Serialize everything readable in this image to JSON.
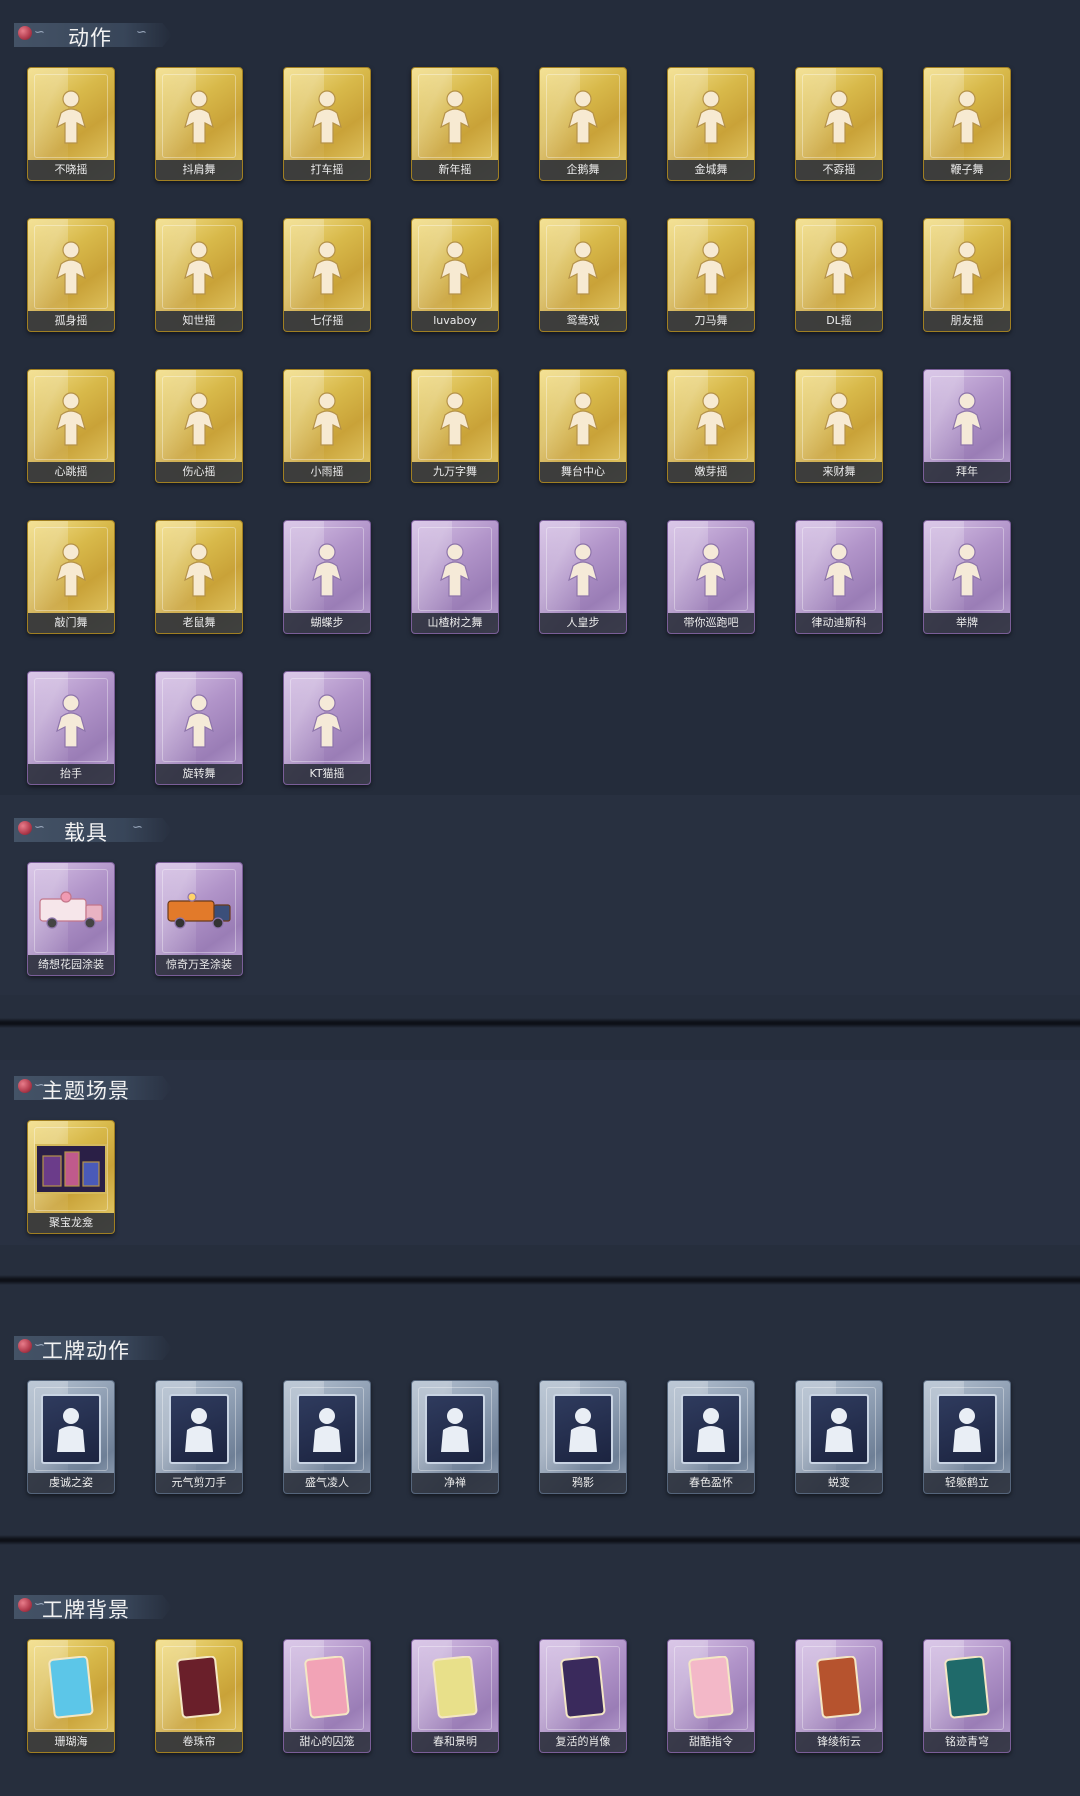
{
  "sections": {
    "actions": {
      "title": "动作",
      "items": [
        {
          "label": "不晓摇",
          "rarity": "gold"
        },
        {
          "label": "抖肩舞",
          "rarity": "gold"
        },
        {
          "label": "打车摇",
          "rarity": "gold"
        },
        {
          "label": "新年摇",
          "rarity": "gold"
        },
        {
          "label": "企鹅舞",
          "rarity": "gold"
        },
        {
          "label": "金城舞",
          "rarity": "gold"
        },
        {
          "label": "不孬摇",
          "rarity": "gold"
        },
        {
          "label": "鞭子舞",
          "rarity": "gold"
        },
        {
          "label": "孤身摇",
          "rarity": "gold"
        },
        {
          "label": "知世摇",
          "rarity": "gold"
        },
        {
          "label": "七仔摇",
          "rarity": "gold"
        },
        {
          "label": "luvaboy",
          "rarity": "gold"
        },
        {
          "label": "鸳鸯戏",
          "rarity": "gold"
        },
        {
          "label": "刀马舞",
          "rarity": "gold"
        },
        {
          "label": "DL摇",
          "rarity": "gold"
        },
        {
          "label": "朋友摇",
          "rarity": "gold"
        },
        {
          "label": "心跳摇",
          "rarity": "gold"
        },
        {
          "label": "伤心摇",
          "rarity": "gold"
        },
        {
          "label": "小雨摇",
          "rarity": "gold"
        },
        {
          "label": "九万字舞",
          "rarity": "gold"
        },
        {
          "label": "舞台中心",
          "rarity": "gold"
        },
        {
          "label": "嫩芽摇",
          "rarity": "gold"
        },
        {
          "label": "来财舞",
          "rarity": "gold"
        },
        {
          "label": "拜年",
          "rarity": "purple"
        },
        {
          "label": "敲门舞",
          "rarity": "gold"
        },
        {
          "label": "老鼠舞",
          "rarity": "gold"
        },
        {
          "label": "蝴蝶步",
          "rarity": "purple"
        },
        {
          "label": "山楂树之舞",
          "rarity": "purple"
        },
        {
          "label": "人皇步",
          "rarity": "purple"
        },
        {
          "label": "带你巡跑吧",
          "rarity": "purple"
        },
        {
          "label": "律动迪斯科",
          "rarity": "purple"
        },
        {
          "label": "举牌",
          "rarity": "purple"
        },
        {
          "label": "抬手",
          "rarity": "purple"
        },
        {
          "label": "旋转舞",
          "rarity": "purple"
        },
        {
          "label": "KT猫摇",
          "rarity": "purple"
        }
      ]
    },
    "vehicles": {
      "title": "载具",
      "items": [
        {
          "label": "绮想花园涂装",
          "rarity": "purple",
          "art": "truck-pink"
        },
        {
          "label": "惊奇万圣涂装",
          "rarity": "purple",
          "art": "truck-orange"
        }
      ]
    },
    "scenes": {
      "title": "主题场景",
      "items": [
        {
          "label": "聚宝龙龛",
          "rarity": "gold",
          "art": "scene"
        }
      ]
    },
    "badge_actions": {
      "title": "工牌动作",
      "items": [
        {
          "label": "虔诚之姿",
          "rarity": "blue"
        },
        {
          "label": "元气剪刀手",
          "rarity": "blue"
        },
        {
          "label": "盛气凌人",
          "rarity": "blue"
        },
        {
          "label": "净禅",
          "rarity": "blue"
        },
        {
          "label": "鸦影",
          "rarity": "blue"
        },
        {
          "label": "春色盈怀",
          "rarity": "blue"
        },
        {
          "label": "蜕变",
          "rarity": "blue"
        },
        {
          "label": "轻躯鹤立",
          "rarity": "blue"
        }
      ]
    },
    "badge_backgrounds": {
      "title": "工牌背景",
      "items": [
        {
          "label": "珊瑚海",
          "rarity": "gold",
          "art_color": "#5cc6e8"
        },
        {
          "label": "卷珠帘",
          "rarity": "gold",
          "art_color": "#6a1f2a"
        },
        {
          "label": "甜心的囚笼",
          "rarity": "purple",
          "art_color": "#f2a3b6"
        },
        {
          "label": "春和景明",
          "rarity": "purple",
          "art_color": "#e8e08a"
        },
        {
          "label": "复活的肖像",
          "rarity": "purple",
          "art_color": "#3a2a5c"
        },
        {
          "label": "甜酷指令",
          "rarity": "purple",
          "art_color": "#f3b8c8"
        },
        {
          "label": "锋绫衔云",
          "rarity": "purple",
          "art_color": "#b6532e"
        },
        {
          "label": "铭迹青穹",
          "rarity": "purple",
          "art_color": "#1f6a6a"
        }
      ]
    }
  }
}
